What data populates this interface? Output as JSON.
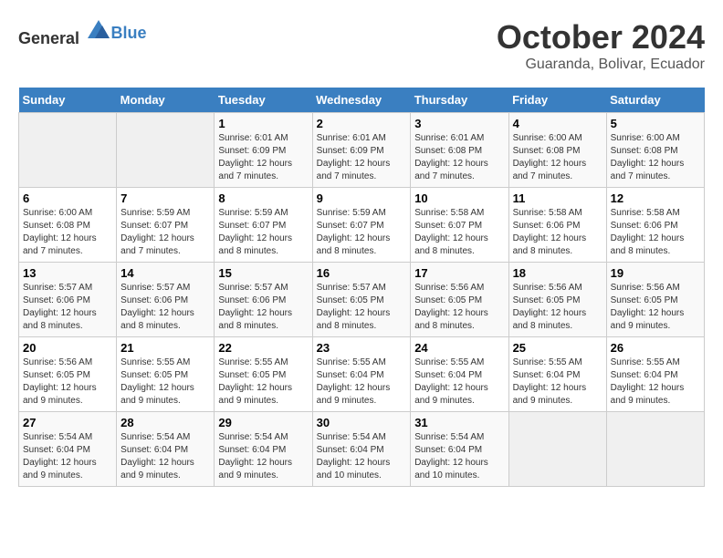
{
  "logo": {
    "general": "General",
    "blue": "Blue"
  },
  "title": {
    "month": "October 2024",
    "location": "Guaranda, Bolivar, Ecuador"
  },
  "days_of_week": [
    "Sunday",
    "Monday",
    "Tuesday",
    "Wednesday",
    "Thursday",
    "Friday",
    "Saturday"
  ],
  "weeks": [
    [
      {
        "day": "",
        "sunrise": "",
        "sunset": "",
        "daylight": ""
      },
      {
        "day": "",
        "sunrise": "",
        "sunset": "",
        "daylight": ""
      },
      {
        "day": "1",
        "sunrise": "Sunrise: 6:01 AM",
        "sunset": "Sunset: 6:09 PM",
        "daylight": "Daylight: 12 hours and 7 minutes."
      },
      {
        "day": "2",
        "sunrise": "Sunrise: 6:01 AM",
        "sunset": "Sunset: 6:09 PM",
        "daylight": "Daylight: 12 hours and 7 minutes."
      },
      {
        "day": "3",
        "sunrise": "Sunrise: 6:01 AM",
        "sunset": "Sunset: 6:08 PM",
        "daylight": "Daylight: 12 hours and 7 minutes."
      },
      {
        "day": "4",
        "sunrise": "Sunrise: 6:00 AM",
        "sunset": "Sunset: 6:08 PM",
        "daylight": "Daylight: 12 hours and 7 minutes."
      },
      {
        "day": "5",
        "sunrise": "Sunrise: 6:00 AM",
        "sunset": "Sunset: 6:08 PM",
        "daylight": "Daylight: 12 hours and 7 minutes."
      }
    ],
    [
      {
        "day": "6",
        "sunrise": "Sunrise: 6:00 AM",
        "sunset": "Sunset: 6:08 PM",
        "daylight": "Daylight: 12 hours and 7 minutes."
      },
      {
        "day": "7",
        "sunrise": "Sunrise: 5:59 AM",
        "sunset": "Sunset: 6:07 PM",
        "daylight": "Daylight: 12 hours and 7 minutes."
      },
      {
        "day": "8",
        "sunrise": "Sunrise: 5:59 AM",
        "sunset": "Sunset: 6:07 PM",
        "daylight": "Daylight: 12 hours and 8 minutes."
      },
      {
        "day": "9",
        "sunrise": "Sunrise: 5:59 AM",
        "sunset": "Sunset: 6:07 PM",
        "daylight": "Daylight: 12 hours and 8 minutes."
      },
      {
        "day": "10",
        "sunrise": "Sunrise: 5:58 AM",
        "sunset": "Sunset: 6:07 PM",
        "daylight": "Daylight: 12 hours and 8 minutes."
      },
      {
        "day": "11",
        "sunrise": "Sunrise: 5:58 AM",
        "sunset": "Sunset: 6:06 PM",
        "daylight": "Daylight: 12 hours and 8 minutes."
      },
      {
        "day": "12",
        "sunrise": "Sunrise: 5:58 AM",
        "sunset": "Sunset: 6:06 PM",
        "daylight": "Daylight: 12 hours and 8 minutes."
      }
    ],
    [
      {
        "day": "13",
        "sunrise": "Sunrise: 5:57 AM",
        "sunset": "Sunset: 6:06 PM",
        "daylight": "Daylight: 12 hours and 8 minutes."
      },
      {
        "day": "14",
        "sunrise": "Sunrise: 5:57 AM",
        "sunset": "Sunset: 6:06 PM",
        "daylight": "Daylight: 12 hours and 8 minutes."
      },
      {
        "day": "15",
        "sunrise": "Sunrise: 5:57 AM",
        "sunset": "Sunset: 6:06 PM",
        "daylight": "Daylight: 12 hours and 8 minutes."
      },
      {
        "day": "16",
        "sunrise": "Sunrise: 5:57 AM",
        "sunset": "Sunset: 6:05 PM",
        "daylight": "Daylight: 12 hours and 8 minutes."
      },
      {
        "day": "17",
        "sunrise": "Sunrise: 5:56 AM",
        "sunset": "Sunset: 6:05 PM",
        "daylight": "Daylight: 12 hours and 8 minutes."
      },
      {
        "day": "18",
        "sunrise": "Sunrise: 5:56 AM",
        "sunset": "Sunset: 6:05 PM",
        "daylight": "Daylight: 12 hours and 8 minutes."
      },
      {
        "day": "19",
        "sunrise": "Sunrise: 5:56 AM",
        "sunset": "Sunset: 6:05 PM",
        "daylight": "Daylight: 12 hours and 9 minutes."
      }
    ],
    [
      {
        "day": "20",
        "sunrise": "Sunrise: 5:56 AM",
        "sunset": "Sunset: 6:05 PM",
        "daylight": "Daylight: 12 hours and 9 minutes."
      },
      {
        "day": "21",
        "sunrise": "Sunrise: 5:55 AM",
        "sunset": "Sunset: 6:05 PM",
        "daylight": "Daylight: 12 hours and 9 minutes."
      },
      {
        "day": "22",
        "sunrise": "Sunrise: 5:55 AM",
        "sunset": "Sunset: 6:05 PM",
        "daylight": "Daylight: 12 hours and 9 minutes."
      },
      {
        "day": "23",
        "sunrise": "Sunrise: 5:55 AM",
        "sunset": "Sunset: 6:04 PM",
        "daylight": "Daylight: 12 hours and 9 minutes."
      },
      {
        "day": "24",
        "sunrise": "Sunrise: 5:55 AM",
        "sunset": "Sunset: 6:04 PM",
        "daylight": "Daylight: 12 hours and 9 minutes."
      },
      {
        "day": "25",
        "sunrise": "Sunrise: 5:55 AM",
        "sunset": "Sunset: 6:04 PM",
        "daylight": "Daylight: 12 hours and 9 minutes."
      },
      {
        "day": "26",
        "sunrise": "Sunrise: 5:55 AM",
        "sunset": "Sunset: 6:04 PM",
        "daylight": "Daylight: 12 hours and 9 minutes."
      }
    ],
    [
      {
        "day": "27",
        "sunrise": "Sunrise: 5:54 AM",
        "sunset": "Sunset: 6:04 PM",
        "daylight": "Daylight: 12 hours and 9 minutes."
      },
      {
        "day": "28",
        "sunrise": "Sunrise: 5:54 AM",
        "sunset": "Sunset: 6:04 PM",
        "daylight": "Daylight: 12 hours and 9 minutes."
      },
      {
        "day": "29",
        "sunrise": "Sunrise: 5:54 AM",
        "sunset": "Sunset: 6:04 PM",
        "daylight": "Daylight: 12 hours and 9 minutes."
      },
      {
        "day": "30",
        "sunrise": "Sunrise: 5:54 AM",
        "sunset": "Sunset: 6:04 PM",
        "daylight": "Daylight: 12 hours and 10 minutes."
      },
      {
        "day": "31",
        "sunrise": "Sunrise: 5:54 AM",
        "sunset": "Sunset: 6:04 PM",
        "daylight": "Daylight: 12 hours and 10 minutes."
      },
      {
        "day": "",
        "sunrise": "",
        "sunset": "",
        "daylight": ""
      },
      {
        "day": "",
        "sunrise": "",
        "sunset": "",
        "daylight": ""
      }
    ]
  ]
}
